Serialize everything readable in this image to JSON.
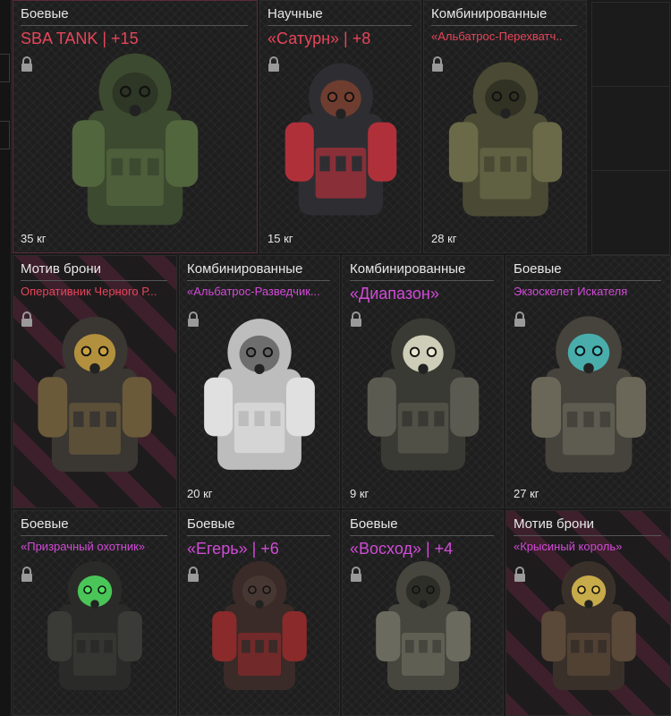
{
  "cards": [
    {
      "category": "Боевые",
      "name": "SBA TANK | +15",
      "name_style": "red",
      "weight": "35 кг",
      "colors": {
        "body": "#3c4a30",
        "accent": "#52663e",
        "visor": "#2b3324"
      }
    },
    {
      "category": "Научные",
      "name": "«Сатурн» | +8",
      "name_style": "red",
      "weight": "15 кг",
      "colors": {
        "body": "#2e2e32",
        "accent": "#b0303a",
        "visor": "#7a4030"
      }
    },
    {
      "category": "Комбинированные",
      "name": "«Альбатрос-Перехватч..",
      "name_style": "red",
      "weight": "28 кг",
      "colors": {
        "body": "#4a4a34",
        "accent": "#6a6a48",
        "visor": "#2e2e22"
      }
    },
    {
      "category": "Мотив брони",
      "name": "Оперативник Черного Р...",
      "name_style": "red",
      "weight": "",
      "colors": {
        "body": "#3a3632",
        "accent": "#6a5a3a",
        "visor": "#c8a040"
      }
    },
    {
      "category": "Комбинированные",
      "name": "«Альбатрос-Разведчик...",
      "name_style": "pink",
      "weight": "20 кг",
      "colors": {
        "body": "#bdbdbd",
        "accent": "#e0e0e0",
        "visor": "#606060"
      }
    },
    {
      "category": "Комбинированные",
      "name": "«Диапазон»",
      "name_style": "pink",
      "weight": "9 кг",
      "colors": {
        "body": "#3a3a34",
        "accent": "#5a5a50",
        "visor": "#e8e8d0"
      }
    },
    {
      "category": "Боевые",
      "name": "Экзоскелет Искателя",
      "name_style": "pink",
      "weight": "27 кг",
      "colors": {
        "body": "#45433c",
        "accent": "#6a6658",
        "visor": "#4ac0c0"
      }
    },
    {
      "category": "Боевые",
      "name": "«Призрачный охотник»",
      "name_style": "pink",
      "weight": "",
      "colors": {
        "body": "#2a2a28",
        "accent": "#3a3a36",
        "visor": "#50e060"
      }
    },
    {
      "category": "Боевые",
      "name": "«Егерь» | +6",
      "name_style": "pink",
      "weight": "",
      "colors": {
        "body": "#3a2a28",
        "accent": "#8a2a2a",
        "visor": "#4a3a34"
      }
    },
    {
      "category": "Боевые",
      "name": "«Восход» | +4",
      "name_style": "pink",
      "weight": "",
      "colors": {
        "body": "#46463e",
        "accent": "#6a6a5e",
        "visor": "#2a2a26"
      }
    },
    {
      "category": "Мотив брони",
      "name": "«Крысиный король»",
      "name_style": "pink",
      "weight": "",
      "colors": {
        "body": "#3a302a",
        "accent": "#5a4838",
        "visor": "#e0c050"
      }
    }
  ]
}
